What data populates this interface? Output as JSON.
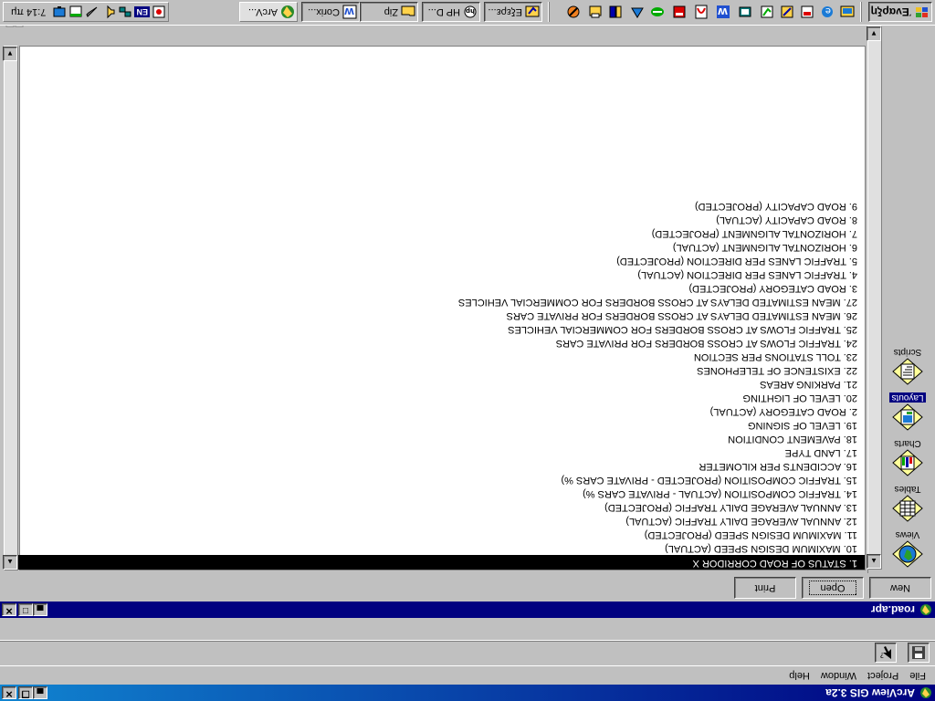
{
  "app": {
    "title": "ArcView GIS 3.2a",
    "menu": [
      "File",
      "Project",
      "Window",
      "Help"
    ]
  },
  "project_window": {
    "title": "road.apr",
    "buttons": {
      "new": "New",
      "open": "Open",
      "print": "Print"
    }
  },
  "sidebar": {
    "items": [
      {
        "label": "Views",
        "icon": "views-icon"
      },
      {
        "label": "Tables",
        "icon": "tables-icon"
      },
      {
        "label": "Charts",
        "icon": "charts-icon"
      },
      {
        "label": "Layouts",
        "icon": "layouts-icon",
        "selected": true
      },
      {
        "label": "Scripts",
        "icon": "scripts-icon"
      }
    ]
  },
  "documents": {
    "items": [
      "1. STATUS OF ROAD CORRIDOR X",
      "10. MAXIMUM DESIGN SPEED (ACTUAL)",
      "11. MAXIMUM DESIGN SPEED (PROJECTED)",
      "12. ANNUAL AVERAGE DAILY TRAFFIC (ACTUAL)",
      "13. ANNUAL AVERAGE DAILY TRAFFIC (PROJECTED)",
      "14. TRAFFIC COMPOSITION (ACTUAL - PRIVATE CARS %)",
      "15. TRAFFIC COMPOSITION (PROJECTED - PRIVATE CARS %)",
      "16. ACCIDENTS PER KILOMETER",
      "17. LAND TYPE",
      "18. PAVEMENT CONDITION",
      "19. LEVEL OF SIGNING",
      "2. ROAD CATEGORY (ACTUAL)",
      "20. LEVEL OF LIGHTING",
      "21. PARKING AREAS",
      "22. EXISTENCE OF TELEPHONES",
      "23. TOLL STATIONS PER SECTION",
      "24. TRAFFIC FLOWS AT CROSS BORDERS FOR PRIVATE CARS",
      "25. TRAFFIC FLOWS AT CROSS BORDERS FOR COMMERCIAL VEHICLES",
      "26. MEAN ESTIMATED DELAYS AT CROSS BORDERS FOR PRIVATE CARS",
      "27. MEAN ESTIMATED DELAYS AT CROSS BORDERS FOR COMMERCIAL VEHICLES",
      "3. ROAD CATEGORY (PROJECTED)",
      "4. TRAFFIC LANES PER DIRECTION (ACTUAL)",
      "5. TRAFFIC LANES PER DIRECTION (PROJECTED)",
      "6. HORIZONTAL ALIGNMENT (ACTUAL)",
      "7. HORIZONTAL ALIGNMENT (PROJECTED)",
      "8. ROAD CAPACITY (ACTUAL)",
      "9. ROAD CAPACITY (PROJECTED)"
    ],
    "selected_index": 0
  },
  "taskbar": {
    "start_label": "Έναρξη",
    "tasks": [
      {
        "label": "Εξερε...",
        "icon": "explorer-icon"
      },
      {
        "label": "HP D...",
        "icon": "hp-icon"
      },
      {
        "label": "Zip",
        "icon": "folder-icon"
      },
      {
        "label": "Corix...",
        "icon": "word-icon"
      },
      {
        "label": "ArcV...",
        "icon": "arcview-icon",
        "active": true
      }
    ],
    "tray": {
      "lang": "EN",
      "clock": "7:14 πμ"
    }
  },
  "colors": {
    "title_bar": "#000080",
    "selection": "#000000",
    "face": "#c0c0c0"
  }
}
